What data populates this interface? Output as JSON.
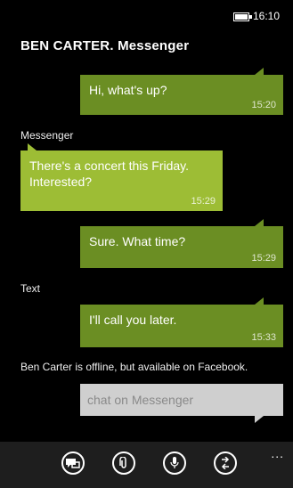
{
  "status": {
    "time": "16:10"
  },
  "header": {
    "title": "BEN CARTER. Messenger"
  },
  "messages": [
    {
      "text": "Hi, what's up?",
      "time": "15:20",
      "direction": "out",
      "color": "#6b8e23"
    },
    {
      "label": "Messenger"
    },
    {
      "text": "There's a concert this Friday. Interested?",
      "time": "15:29",
      "direction": "in",
      "color": "#9dbd35"
    },
    {
      "text": "Sure. What time?",
      "time": "15:29",
      "direction": "out",
      "color": "#6b8e23"
    },
    {
      "label": "Text"
    },
    {
      "text": "I'll call you later.",
      "time": "15:33",
      "direction": "out",
      "color": "#6b8e23"
    }
  ],
  "offline_notice": "Ben Carter is offline, but available on Facebook.",
  "compose": {
    "placeholder": "chat on Messenger"
  },
  "app_bar": {
    "buttons": [
      {
        "icon": "switch-chat-icon"
      },
      {
        "icon": "attach-icon"
      },
      {
        "icon": "microphone-icon"
      },
      {
        "icon": "send-icon"
      }
    ],
    "more_label": "..."
  }
}
